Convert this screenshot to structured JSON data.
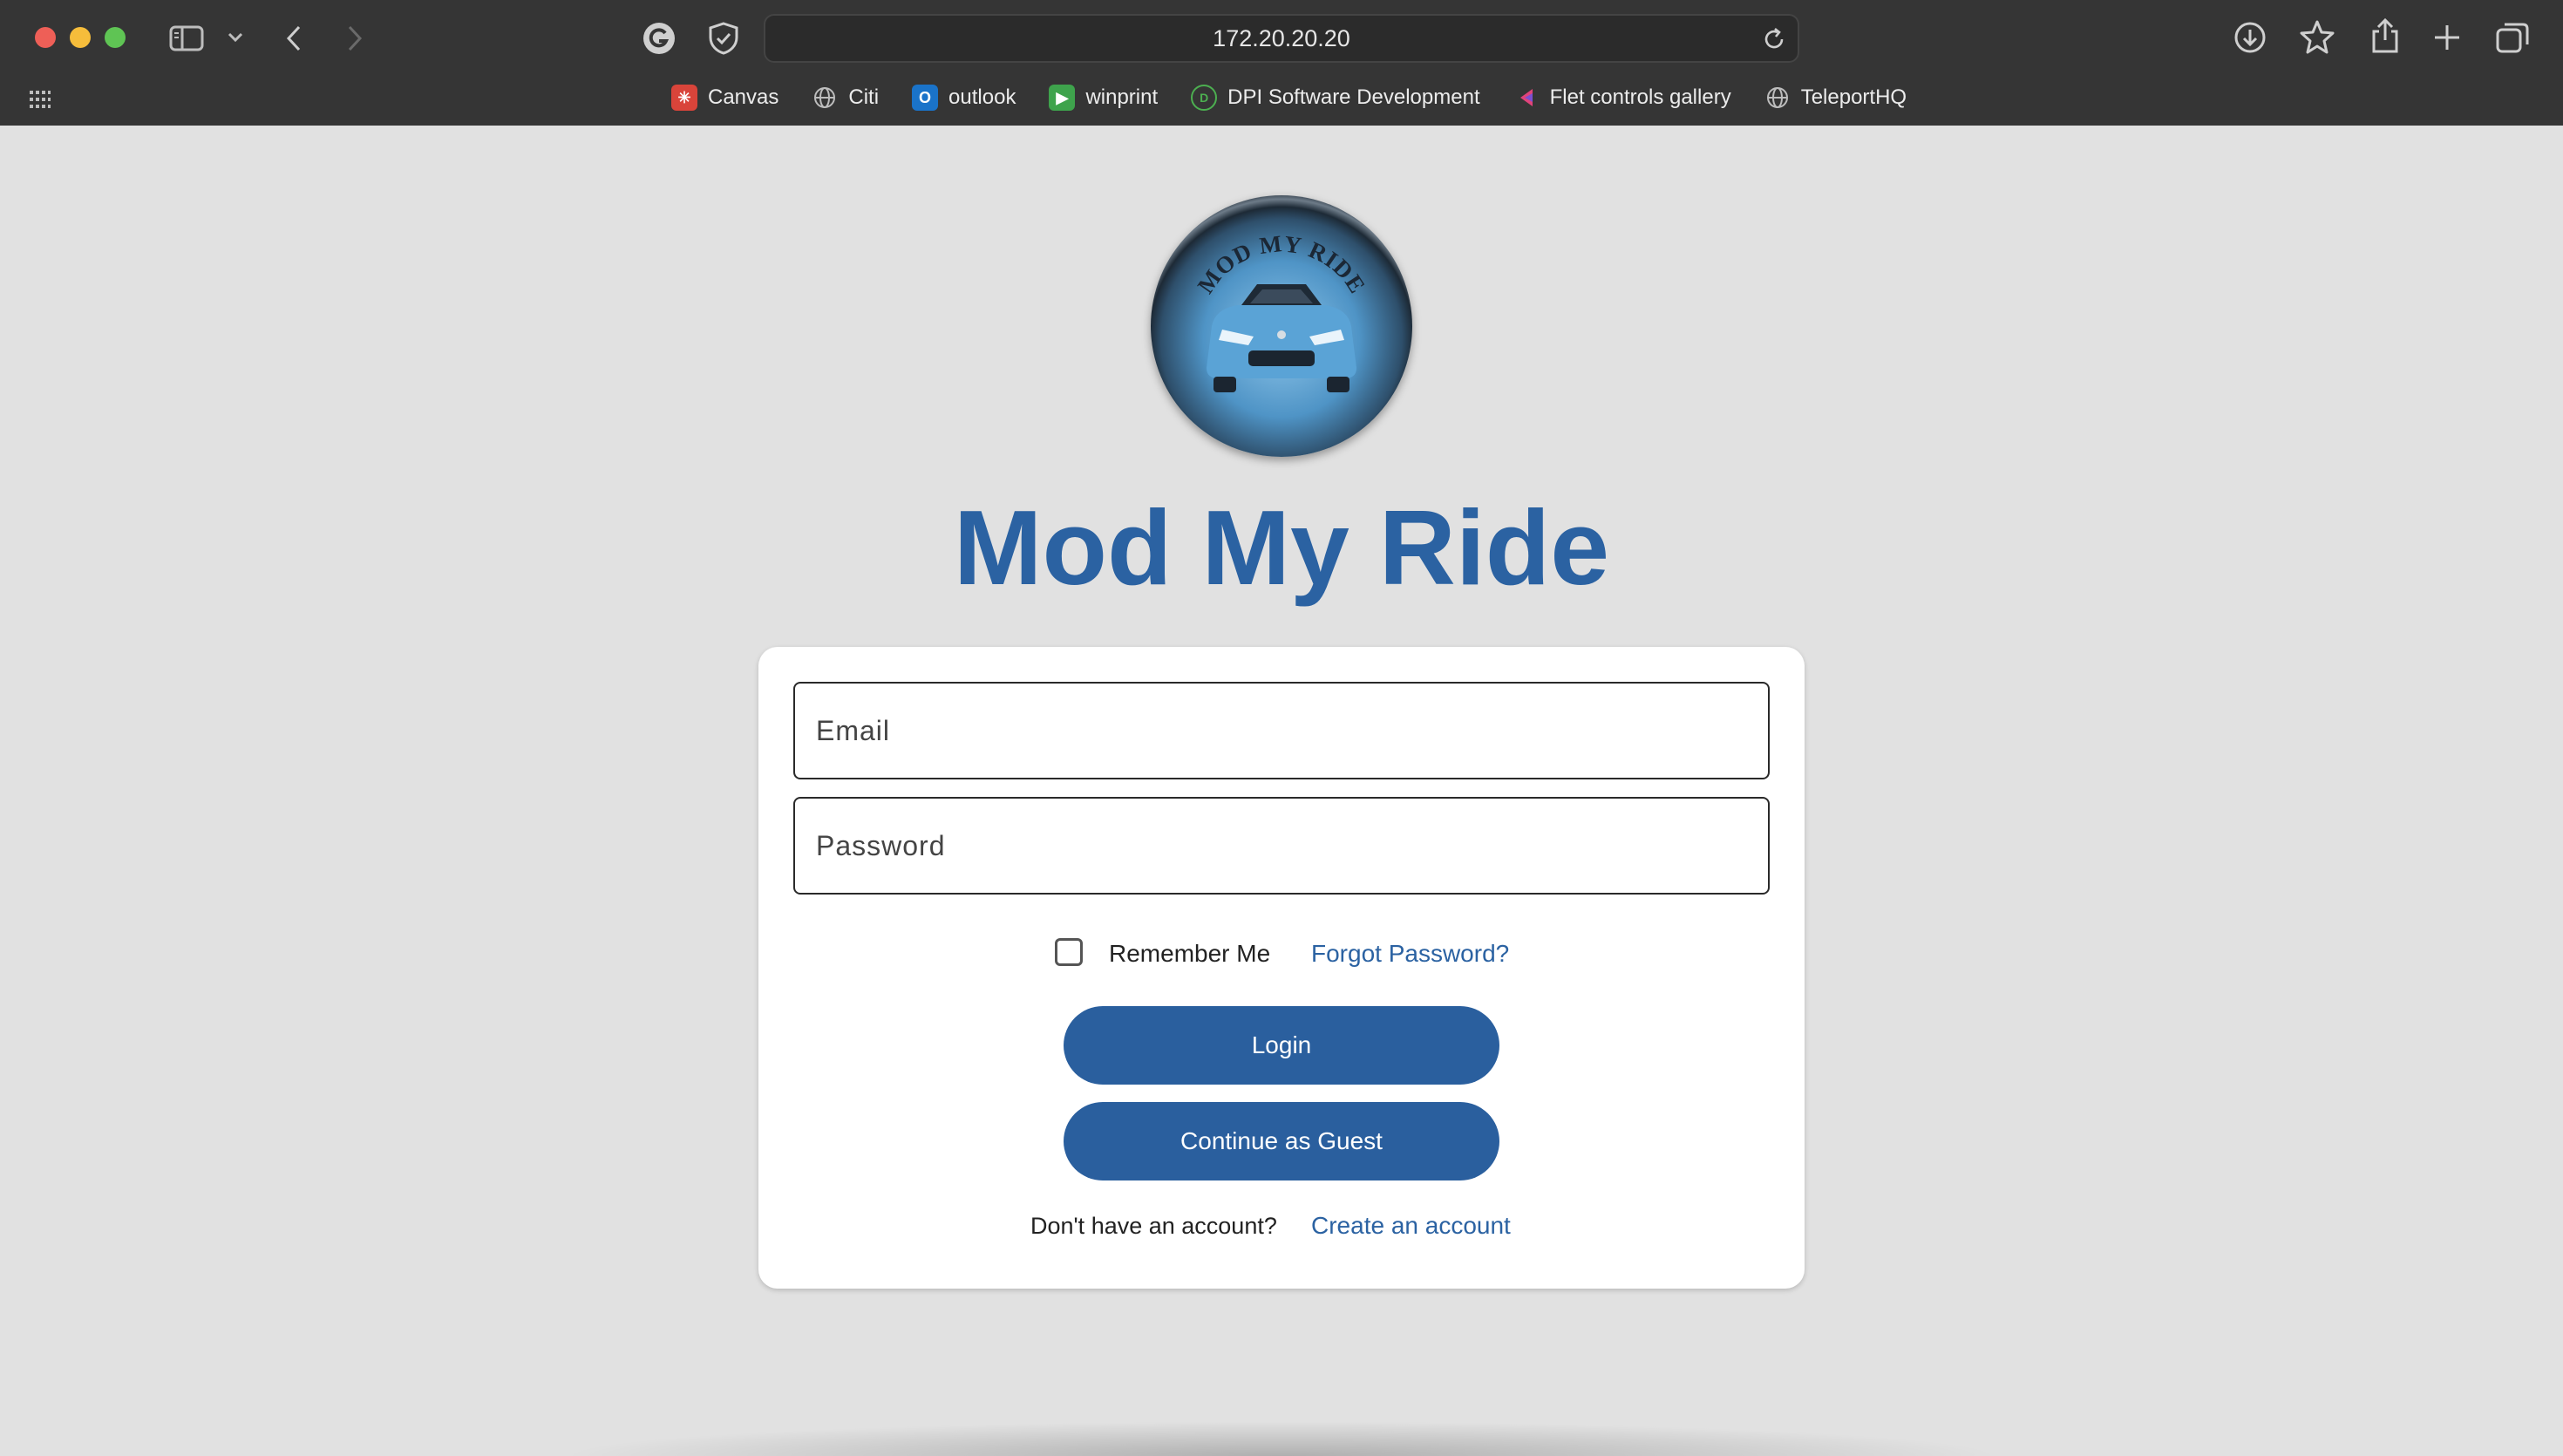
{
  "browser": {
    "url": "172.20.20.20",
    "bookmarks": [
      {
        "label": "Canvas",
        "icon": "canvas-icon"
      },
      {
        "label": "Citi",
        "icon": "globe-icon"
      },
      {
        "label": "outlook",
        "icon": "outlook-icon"
      },
      {
        "label": "winprint",
        "icon": "winprint-icon"
      },
      {
        "label": "DPI Software Development",
        "icon": "dpi-icon"
      },
      {
        "label": "Flet controls gallery",
        "icon": "flet-icon"
      },
      {
        "label": "TeleportHQ",
        "icon": "globe-icon"
      }
    ]
  },
  "app": {
    "logo_text": "MOD MY RIDE",
    "title": "Mod My Ride"
  },
  "login": {
    "email_placeholder": "Email",
    "password_placeholder": "Password",
    "remember_label": "Remember Me",
    "remember_checked": false,
    "forgot_label": "Forgot Password?",
    "login_label": "Login",
    "guest_label": "Continue as Guest",
    "signup_question": "Don't have an account?",
    "signup_link": "Create an account"
  },
  "colors": {
    "brand": "#2b62a2",
    "button": "#2a5f9e",
    "page_bg": "#e1e1e1"
  }
}
